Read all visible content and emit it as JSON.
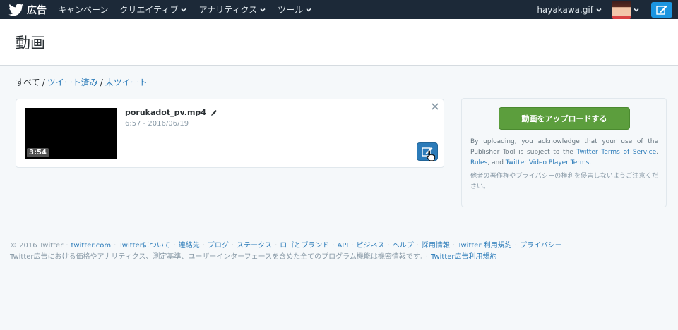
{
  "topbar": {
    "brand": "広告",
    "nav": [
      {
        "label": "キャンペーン",
        "has_menu": false
      },
      {
        "label": "クリエイティブ",
        "has_menu": true
      },
      {
        "label": "アナリティクス",
        "has_menu": true
      },
      {
        "label": "ツール",
        "has_menu": true
      }
    ],
    "account": "hayakawa.gif"
  },
  "page": {
    "title": "動画",
    "filter": {
      "all": "すべて",
      "tweeted": "ツイート済み",
      "untweeted": "未ツイート"
    }
  },
  "video": {
    "duration": "3:54",
    "filename": "porukadot_pv.mp4",
    "meta": "6:57 - 2016/06/19"
  },
  "upload": {
    "button": "動画をアップロードする",
    "desc_prefix": "By uploading, you acknowledge that your use of the Publisher Tool is subject to the ",
    "link_tos": "Twitter Terms of Service",
    "desc_mid1": ", ",
    "link_rules": "Rules",
    "desc_mid2": ", and ",
    "link_player": "Twitter Video Player Terms",
    "desc_suffix": ".",
    "note": "他者の著作権やプライバシーの権利を侵害しないようご注意ください。"
  },
  "footer": {
    "copyright": "© 2016 Twitter",
    "links": [
      "twitter.com",
      "Twitterについて",
      "連絡先",
      "ブログ",
      "ステータス",
      "ロゴとブランド",
      "API",
      "ビジネス",
      "ヘルプ",
      "採用情報",
      "Twitter 利用規約",
      "プライバシー"
    ],
    "notice": "Twitter広告における価格やアナリティクス、測定基準、ユーザーインターフェースを含めた全てのプログラム機能は機密情報です。",
    "ads_terms": "Twitter広告利用規約"
  },
  "colors": {
    "topbar": "#1c2938",
    "link": "#2b7bb9",
    "upload_button": "#5c9e3d",
    "compose": "#1b95e0"
  },
  "icons": [
    "twitter-bird-icon",
    "chevron-down-icon",
    "compose-icon",
    "pencil-icon",
    "close-icon",
    "hand-cursor-icon"
  ]
}
